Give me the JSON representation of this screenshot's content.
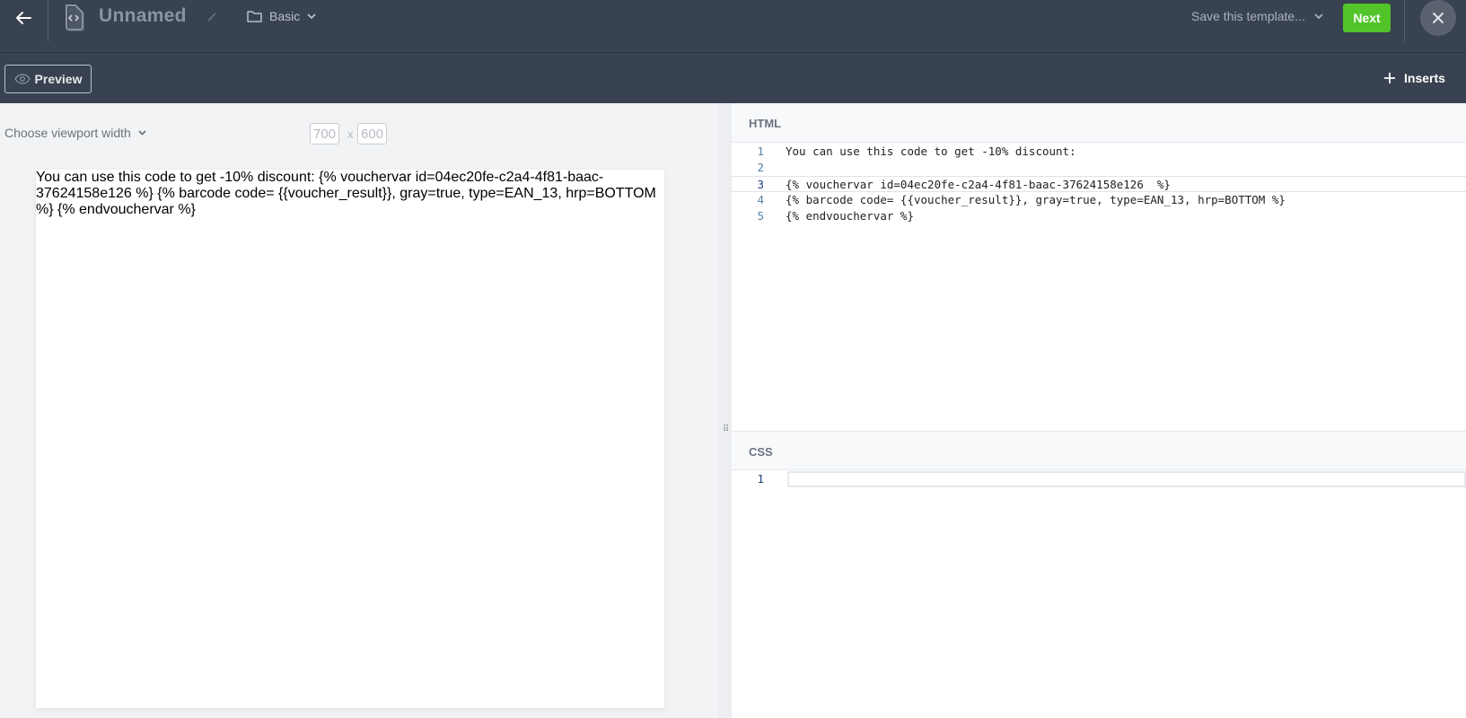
{
  "topbar": {
    "back_icon": "arrow-left-icon",
    "doc_icon": "code-document-icon",
    "title": "Unnamed",
    "edit_icon": "pencil-icon",
    "folder_icon": "folder-icon",
    "folder_label": "Basic",
    "save_template_label": "Save this template...",
    "next_label": "Next",
    "close_icon": "close-icon",
    "colors": {
      "background": "#394250",
      "next": "#52c42a"
    }
  },
  "subbar": {
    "preview_label": "Preview",
    "preview_icon": "eye-icon",
    "inserts_label": "Inserts",
    "inserts_icon": "plus-icon"
  },
  "preview": {
    "viewport_label": "Choose viewport width",
    "width": "700",
    "height": "600",
    "separator": "x",
    "content": "You can use this code to get -10% discount: {% vouchervar id=04ec20fe-c2a4-4f81-baac-37624158e126 %} {% barcode code= {{voucher_result}}, gray=true, type=EAN_13, hrp=BOTTOM %} {% endvouchervar %}"
  },
  "html_editor": {
    "header": "HTML",
    "lines": [
      {
        "num": "1",
        "text": "You can use this code to get -10% discount:"
      },
      {
        "num": "2",
        "text": ""
      },
      {
        "num": "3",
        "text": "{% vouchervar id=04ec20fe-c2a4-4f81-baac-37624158e126  %}"
      },
      {
        "num": "4",
        "text": "{% barcode code= {{voucher_result}}, gray=true, type=EAN_13, hrp=BOTTOM %}"
      },
      {
        "num": "5",
        "text": "{% endvouchervar %}"
      }
    ]
  },
  "css_editor": {
    "header": "CSS",
    "lines": [
      {
        "num": "1",
        "text": ""
      }
    ]
  }
}
